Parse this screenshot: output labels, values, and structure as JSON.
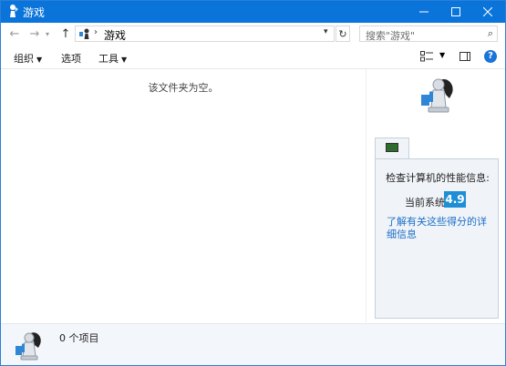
{
  "window": {
    "title": "游戏"
  },
  "nav": {
    "back_glyph": "←",
    "forward_glyph": "→",
    "recent_glyph": "▾",
    "up_glyph": "↑",
    "breadcrumb": "游戏",
    "refresh_glyph": "↻",
    "search_placeholder": "搜索\"游戏\"",
    "search_icon": "⌕"
  },
  "toolbar": {
    "organize": "组织",
    "options": "选项",
    "tools": "工具",
    "help": "?"
  },
  "content": {
    "empty_message": "该文件夹为空。"
  },
  "details_pane": {
    "performance_title": "检查计算机的性能信息:",
    "current_system_label": "当前系统",
    "score": "4.9",
    "link_text": "了解有关这些得分的详细信息"
  },
  "status": {
    "item_count": "0 个项目"
  },
  "colors": {
    "titlebar": "#0a74da",
    "score_badge": "#1e8fd6",
    "link": "#1a6fc9"
  }
}
